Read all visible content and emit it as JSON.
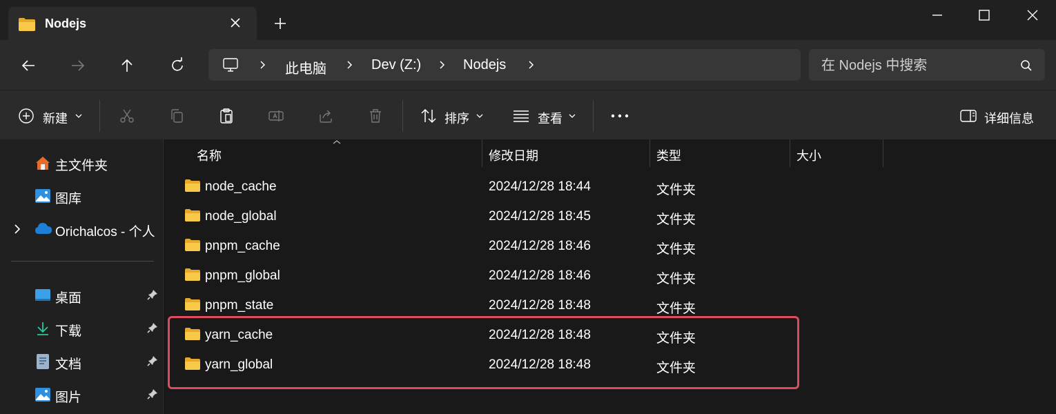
{
  "window": {
    "tab_title": "Nodejs",
    "icons": [
      "folder-icon",
      "close-icon",
      "add-icon",
      "minimize-icon",
      "maximize-icon",
      "close-window-icon"
    ]
  },
  "nav": {
    "breadcrumbs": [
      "此电脑",
      "Dev (Z:)",
      "Nodejs"
    ],
    "search_placeholder": "在 Nodejs 中搜索"
  },
  "toolbar": {
    "new_label": "新建",
    "sort_label": "排序",
    "view_label": "查看",
    "details_label": "详细信息"
  },
  "sidebar": {
    "top_items": [
      {
        "label": "主文件夹",
        "icon": "home-icon"
      },
      {
        "label": "图库",
        "icon": "gallery-icon"
      },
      {
        "label": "Orichalcos - 个人",
        "icon": "onedrive-cloud-icon"
      }
    ],
    "pinned_items": [
      {
        "label": "桌面",
        "icon": "desktop-icon"
      },
      {
        "label": "下载",
        "icon": "download-icon"
      },
      {
        "label": "文档",
        "icon": "documents-icon"
      },
      {
        "label": "图片",
        "icon": "pictures-icon"
      }
    ]
  },
  "list": {
    "columns": [
      "名称",
      "修改日期",
      "类型",
      "大小"
    ],
    "rows": [
      {
        "name": "node_cache",
        "date": "2024/12/28 18:44",
        "type": "文件夹"
      },
      {
        "name": "node_global",
        "date": "2024/12/28 18:45",
        "type": "文件夹"
      },
      {
        "name": "pnpm_cache",
        "date": "2024/12/28 18:46",
        "type": "文件夹"
      },
      {
        "name": "pnpm_global",
        "date": "2024/12/28 18:46",
        "type": "文件夹"
      },
      {
        "name": "pnpm_state",
        "date": "2024/12/28 18:48",
        "type": "文件夹"
      },
      {
        "name": "yarn_cache",
        "date": "2024/12/28 18:48",
        "type": "文件夹"
      },
      {
        "name": "yarn_global",
        "date": "2024/12/28 18:48",
        "type": "文件夹"
      }
    ]
  },
  "colors": {
    "highlight_border": "#e04a5f",
    "folder_yellow": "#f8c849",
    "background": "#191919"
  }
}
